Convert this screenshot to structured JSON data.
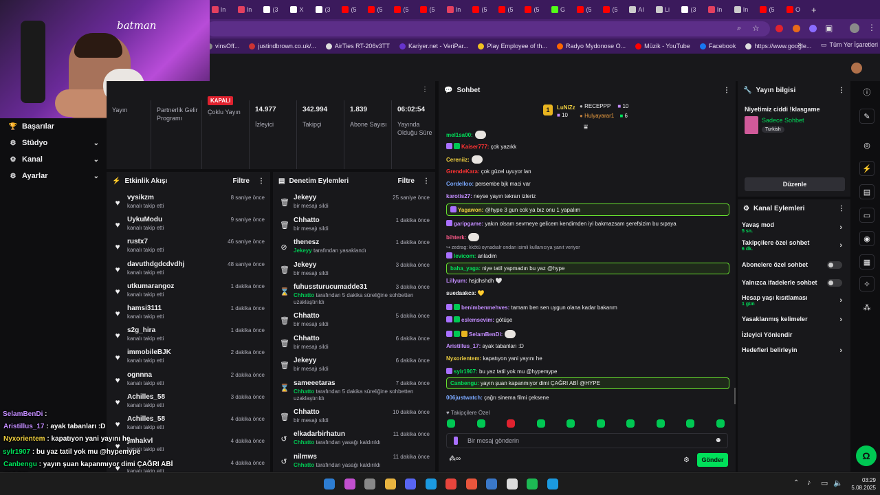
{
  "browser": {
    "tabs": [
      {
        "label": "In",
        "color": "#e4405f"
      },
      {
        "label": "In",
        "color": "#e4405f"
      },
      {
        "label": "(3",
        "color": "#ffffff"
      },
      {
        "label": "X",
        "color": "#ffffff"
      },
      {
        "label": "(3",
        "color": "#ffffff"
      },
      {
        "label": "(5",
        "color": "#ff0000"
      },
      {
        "label": "(5",
        "color": "#ff0000"
      },
      {
        "label": "(5",
        "color": "#ff0000"
      },
      {
        "label": "(5",
        "color": "#ff0000"
      },
      {
        "label": "In",
        "color": "#e4405f"
      },
      {
        "label": "(5",
        "color": "#ff0000"
      },
      {
        "label": "(5",
        "color": "#ff0000"
      },
      {
        "label": "(5",
        "color": "#ff0000"
      },
      {
        "label": "G",
        "color": "#53fc18"
      },
      {
        "label": "(5",
        "color": "#ff0000"
      },
      {
        "label": "(5",
        "color": "#ff0000"
      },
      {
        "label": "AI",
        "color": "#cccccc"
      },
      {
        "label": "Li",
        "color": "#cccccc"
      },
      {
        "label": "(3",
        "color": "#ffffff"
      },
      {
        "label": "In",
        "color": "#e4405f"
      },
      {
        "label": "In",
        "color": "#cccccc"
      },
      {
        "label": "(5",
        "color": "#ff0000"
      },
      {
        "label": "O",
        "color": "#ff0000"
      }
    ],
    "new_tab": "+",
    "bookmarks": [
      {
        "label": "vinsOff...",
        "color": "#888888"
      },
      {
        "label": "justindbrown.co.uk/...",
        "color": "#cc3333"
      },
      {
        "label": "AirTies RT-206v3TT",
        "color": "#dddddd"
      },
      {
        "label": "Kariyer.net - VeriPar...",
        "color": "#6633cc"
      },
      {
        "label": "Play Employee of th...",
        "color": "#f0c020"
      },
      {
        "label": "Radyo Mydonose O...",
        "color": "#ff6600"
      },
      {
        "label": "Müzik - YouTube",
        "color": "#ff0000"
      },
      {
        "label": "Facebook",
        "color": "#1877f2"
      },
      {
        "label": "https://www.google...",
        "color": "#dddddd"
      }
    ],
    "bookmarks_more": "»",
    "all_bookmarks": "Tüm Yer İşaretleri"
  },
  "webcam": {
    "signature": "batman"
  },
  "sidebar": {
    "items": [
      {
        "label": "Başarılar",
        "icon": "trophy-icon",
        "glyph": "🏆",
        "chevron": ""
      },
      {
        "label": "Stüdyo",
        "icon": "studio-icon",
        "glyph": "⚙",
        "chevron": "⌄"
      },
      {
        "label": "Kanal",
        "icon": "channel-icon",
        "glyph": "⚙",
        "chevron": "⌄"
      },
      {
        "label": "Ayarlar",
        "icon": "settings-icon",
        "glyph": "⚙",
        "chevron": "⌄"
      }
    ]
  },
  "stats": {
    "items": [
      {
        "value": "",
        "label": "Yayın"
      },
      {
        "value": "",
        "label": "Partnerlik Gelir Programı"
      },
      {
        "value": "KAPALI",
        "label": "Çoklu Yayın"
      },
      {
        "value": "14.977",
        "label": "İzleyici"
      },
      {
        "value": "342.994",
        "label": "Takipçi"
      },
      {
        "value": "1.839",
        "label": "Abone Sayısı"
      },
      {
        "value": "06:02:54",
        "label": "Yayında Olduğu Süre"
      }
    ]
  },
  "activity": {
    "title": "Etkinlik Akışı",
    "filter": "Filtre",
    "rows": [
      {
        "name": "vysikzm",
        "sub": "kanalı takip etti",
        "time": "8 saniye önce"
      },
      {
        "name": "UykuModu",
        "sub": "kanalı takip etti",
        "time": "9 saniye önce"
      },
      {
        "name": "rustx7",
        "sub": "kanalı takip etti",
        "time": "46 saniye önce"
      },
      {
        "name": "davuthdgdcdvdhj",
        "sub": "kanalı takip etti",
        "time": "48 saniye önce"
      },
      {
        "name": "utkumarangoz",
        "sub": "kanalı takip etti",
        "time": "1 dakika önce"
      },
      {
        "name": "hamsi3111",
        "sub": "kanalı takip etti",
        "time": "1 dakika önce"
      },
      {
        "name": "s2g_hira",
        "sub": "kanalı takip etti",
        "time": "1 dakika önce"
      },
      {
        "name": "immobileBJK",
        "sub": "kanalı takip etti",
        "time": "2 dakika önce"
      },
      {
        "name": "ognnna",
        "sub": "kanalı takip etti",
        "time": "2 dakika önce"
      },
      {
        "name": "Achilles_58",
        "sub": "kanalı takip etti",
        "time": "3 dakika önce"
      },
      {
        "name": "Achilles_58",
        "sub": "kanalı takip etti",
        "time": "4 dakika önce"
      },
      {
        "name": "jmhakvl",
        "sub": "kanalı takip etti",
        "time": "4 dakika önce"
      },
      {
        "name": "",
        "sub": "kanalı takip etti",
        "time": "4 dakika önce"
      }
    ]
  },
  "moderation": {
    "title": "Denetim Eylemleri",
    "filter": "Filtre",
    "rows": [
      {
        "icon": "trash-icon",
        "glyph": "🗑",
        "name": "Jekeyy",
        "by": "",
        "sub": "bir mesajı sildi",
        "time": "25 saniye önce",
        "tall": false
      },
      {
        "icon": "trash-icon",
        "glyph": "🗑",
        "name": "Chhatto",
        "by": "",
        "sub": "bir mesajı sildi",
        "time": "1 dakika önce",
        "tall": false
      },
      {
        "icon": "ban-icon",
        "glyph": "⊘",
        "name": "thenesz",
        "by": "Jekeyy",
        "sub": "tarafından yasaklandı",
        "time": "1 dakika önce",
        "tall": false
      },
      {
        "icon": "trash-icon",
        "glyph": "🗑",
        "name": "Jekeyy",
        "by": "",
        "sub": "bir mesajı sildi",
        "time": "3 dakika önce",
        "tall": false
      },
      {
        "icon": "hourglass-icon",
        "glyph": "⌛",
        "name": "fuhussturucumadde31",
        "by": "Chhatto",
        "sub": "tarafından 5 dakika süreliğine sohbetten uzaklaştırıldı",
        "time": "3 dakika önce",
        "tall": true
      },
      {
        "icon": "trash-icon",
        "glyph": "🗑",
        "name": "Chhatto",
        "by": "",
        "sub": "bir mesajı sildi",
        "time": "5 dakika önce",
        "tall": false
      },
      {
        "icon": "trash-icon",
        "glyph": "🗑",
        "name": "Chhatto",
        "by": "",
        "sub": "bir mesajı sildi",
        "time": "6 dakika önce",
        "tall": false
      },
      {
        "icon": "trash-icon",
        "glyph": "🗑",
        "name": "Jekeyy",
        "by": "",
        "sub": "bir mesajı sildi",
        "time": "6 dakika önce",
        "tall": false
      },
      {
        "icon": "hourglass-icon",
        "glyph": "⌛",
        "name": "sameeetaras",
        "by": "Chhatto",
        "sub": "tarafından 5 dakika süreliğine sohbetten uzaklaştırıldı",
        "time": "7 dakika önce",
        "tall": true
      },
      {
        "icon": "trash-icon",
        "glyph": "🗑",
        "name": "Chhatto",
        "by": "",
        "sub": "bir mesajı sildi",
        "time": "10 dakika önce",
        "tall": false
      },
      {
        "icon": "unban-icon",
        "glyph": "↺",
        "name": "elkadarbirhatun",
        "by": "Chhatto",
        "sub": "tarafından yasağı kaldırıldı",
        "time": "11 dakika önce",
        "tall": false
      },
      {
        "icon": "unban-icon",
        "glyph": "↺",
        "name": "nilmws",
        "by": "Chhatto",
        "sub": "tarafından yasağı kaldırıldı",
        "time": "11 dakika önce",
        "tall": false
      }
    ]
  },
  "chat": {
    "title": "Sohbet",
    "leaderboard": {
      "first_rank": "1",
      "first_name": "LuNiZz",
      "first_count": "10",
      "second_name": "RECEPPP",
      "second_count": "10",
      "third_name": "Hulyayarar1",
      "third_count": "6"
    },
    "messages": [
      {
        "user": "mel1sa00:",
        "color": "#00e05a",
        "text": "",
        "emote": true,
        "hl": false,
        "badges": 0
      },
      {
        "user": "Kaiser777:",
        "color": "#ff3333",
        "text": "çok yazıkk",
        "emote": false,
        "hl": false,
        "badges": 2
      },
      {
        "user": "Cereniiz:",
        "color": "#f0d040",
        "text": "",
        "emote": true,
        "hl": false,
        "badges": 0
      },
      {
        "user": "GrendeKara:",
        "color": "#ff3333",
        "text": "çok güzel uyuyor lan",
        "emote": false,
        "hl": false,
        "badges": 0
      },
      {
        "user": "Cordelloo:",
        "color": "#7aa8ff",
        "text": "persembe bjk maci var",
        "emote": false,
        "hl": false,
        "badges": 0
      },
      {
        "user": "karotis27:",
        "color": "#c38dff",
        "text": "neyse yayın tekrarı izleriz",
        "emote": false,
        "hl": false,
        "badges": 0
      },
      {
        "user": "Yagawon:",
        "color": "#f0d040",
        "text": "@hype 3 gun cok ya bız onu 1 yapalım",
        "emote": false,
        "hl": true,
        "badges": 1
      },
      {
        "user": "garipgame:",
        "color": "#c38dff",
        "text": "yakın olsam sevmeye gelicem kendimden iyi bakmazsam şerefsizim bu sıpaya",
        "emote": false,
        "hl": false,
        "badges": 1
      },
      {
        "user": "bihterk:",
        "color": "#ff5a8a",
        "text": "",
        "emote": true,
        "hl": false,
        "badges": 0
      },
      {
        "user": "",
        "color": "#adadb8",
        "text": "↪ zedrag: kkötü oynadıalr ondan isimli kullanıcıya yanıt veriyor",
        "emote": false,
        "hl": false,
        "badges": 0
      },
      {
        "user": "levicom:",
        "color": "#00e05a",
        "text": "anladim",
        "emote": false,
        "hl": false,
        "badges": 1
      },
      {
        "user": "baha_yaga:",
        "color": "#00e05a",
        "text": "niye tatil yapmadın bu yaz @hype",
        "emote": false,
        "hl": true,
        "badges": 0
      },
      {
        "user": "Lillyum:",
        "color": "#c38dff",
        "text": "hsjdhshdh 🤍",
        "emote": false,
        "hl": false,
        "badges": 0
      },
      {
        "user": "suedaakca:",
        "color": "#efeff1",
        "text": "💛",
        "emote": false,
        "hl": false,
        "badges": 0
      },
      {
        "user": "benimbenmehves:",
        "color": "#c38dff",
        "text": "tamam ben sen uygun olana kadar bakarım",
        "emote": false,
        "hl": false,
        "badges": 2
      },
      {
        "user": "eslemsevim:",
        "color": "#c38dff",
        "text": "götüşe",
        "emote": false,
        "hl": false,
        "badges": 2
      },
      {
        "user": "SelamBenDi:",
        "color": "#c38dff",
        "text": "",
        "emote": true,
        "hl": false,
        "badges": 3
      },
      {
        "user": "Aristillus_17:",
        "color": "#c38dff",
        "text": "ayak tabanları :D",
        "emote": false,
        "hl": false,
        "badges": 0
      },
      {
        "user": "Nyxorientem:",
        "color": "#f0d040",
        "text": "kapatıyon yani yayını he",
        "emote": false,
        "hl": false,
        "badges": 0
      },
      {
        "user": "sylr1907:",
        "color": "#00e05a",
        "text": "bu yaz tatil yok mu @hypemype",
        "emote": false,
        "hl": false,
        "badges": 1
      },
      {
        "user": "Canbengu:",
        "color": "#00e05a",
        "text": "yayın şuan kapanmıyor dimi ÇAĞRI ABİ @HYPE",
        "emote": false,
        "hl": true,
        "badges": 0
      },
      {
        "user": "006justwatch:",
        "color": "#7aa8ff",
        "text": "çağrı sinema filmi çeksene",
        "emote": false,
        "hl": false,
        "badges": 0
      }
    ],
    "followers_only": "♥ Takipçilere Özel",
    "input_placeholder": "Bir mesaj gönderin",
    "send": "Gönder"
  },
  "stream_info": {
    "title": "Yayın bilgisi",
    "stream_title": "Niyetimiz ciddi !klasgame",
    "category": "Sadece Sohbet",
    "tag": "Turkish",
    "edit": "Düzenle"
  },
  "channel_actions": {
    "title": "Kanal Eylemleri",
    "items": [
      {
        "label": "Yavaş mod",
        "sub": "5 sn.",
        "control": "arrow"
      },
      {
        "label": "Takipçilere özel sohbet",
        "sub": "6 dk.",
        "control": "arrow"
      },
      {
        "label": "Abonelere özel sohbet",
        "sub": "",
        "control": "toggle"
      },
      {
        "label": "Yalnızca ifadelerle sohbet",
        "sub": "",
        "control": "toggle"
      },
      {
        "label": "Hesap yaşı kısıtlaması",
        "sub": "1 gün",
        "control": "arrow"
      },
      {
        "label": "Yasaklanmış kelimeler",
        "sub": "",
        "control": "arrow"
      },
      {
        "label": "İzleyici Yönlendir",
        "sub": "",
        "control": "none"
      },
      {
        "label": "Hedefleri belirleyin",
        "sub": "",
        "control": "arrow"
      }
    ]
  },
  "overlay": {
    "lines": [
      {
        "user": "SelamBenDi",
        "user_color": "#c38dff",
        "text": " :"
      },
      {
        "user": "Aristillus_17",
        "user_color": "#c38dff",
        "text": " : ayak tabanları :D"
      },
      {
        "user": "Nyxorientem",
        "user_color": "#f0d040",
        "text": " : kapatıyon yani yayını he"
      },
      {
        "user": "sylr1907",
        "user_color": "#00e05a",
        "text": " : bu yaz tatil yok mu @hypemype"
      },
      {
        "user": "Canbengu",
        "user_color": "#00e05a",
        "text": " : yayın şuan kapanmıyor dimi ÇAĞRI ABİ"
      },
      {
        "user": "",
        "user_color": "#ffffff",
        "text": "@HYPE"
      },
      {
        "user": "",
        "user_color": "#ffffff",
        "text": "nema filmi çeksene"
      }
    ]
  },
  "taskbar": {
    "time": "03:29",
    "date": "5.08.2025",
    "apps": [
      "#2d7dd2",
      "#c24fcf",
      "#888888",
      "#e8b440",
      "#5865f2",
      "#1b9ae0",
      "#e8453c",
      "#e8553c",
      "#3a78c8",
      "#dddddd",
      "#1db954",
      "#1b9ae0"
    ]
  }
}
